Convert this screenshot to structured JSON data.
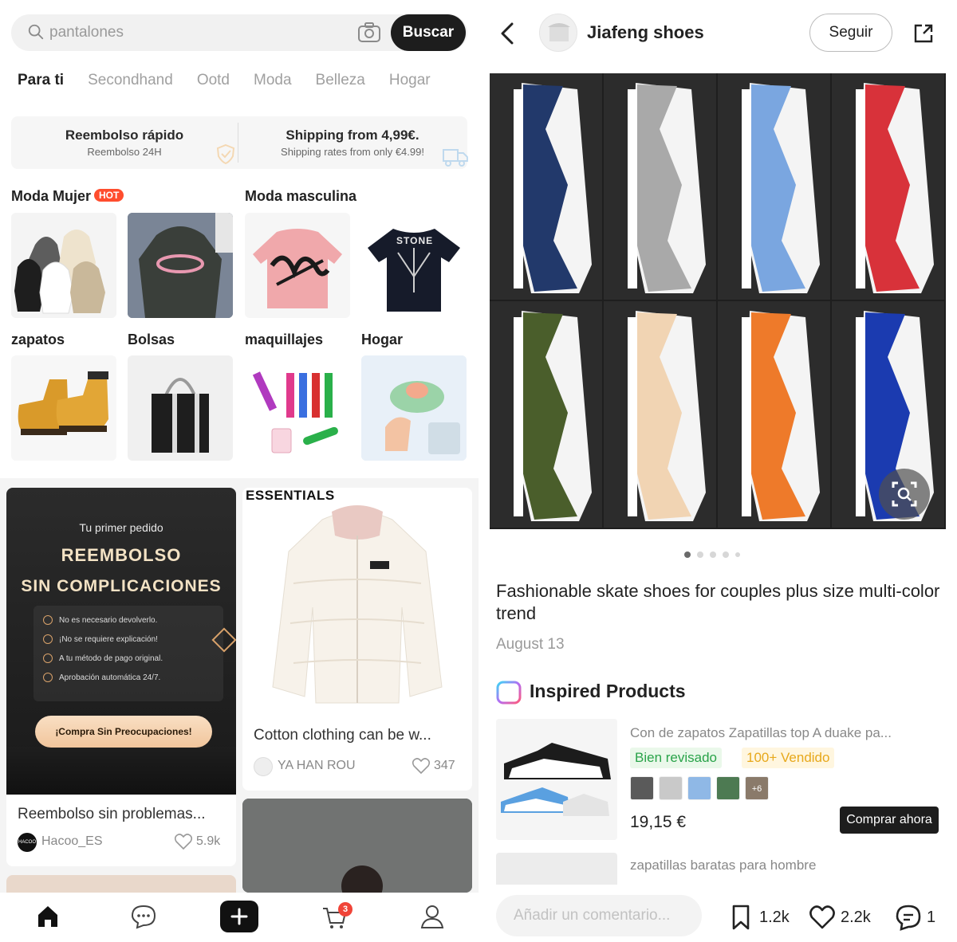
{
  "left": {
    "search": {
      "placeholder": "pantalones",
      "button": "Buscar"
    },
    "tabs": [
      "Para ti",
      "Secondhand",
      "Ootd",
      "Moda",
      "Belleza",
      "Hogar"
    ],
    "banner": {
      "left_title": "Reembolso rápido",
      "left_sub": "Reembolso 24H",
      "right_title": "Shipping from 4,99€.",
      "right_sub": "Shipping rates from only €4.99!"
    },
    "categories": {
      "moda_mujer": "Moda Mujer",
      "hot": "HOT",
      "moda_masculina": "Moda masculina",
      "zapatos": "zapatos",
      "bolsas": "Bolsas",
      "maquillajes": "maquillajes",
      "hogar": "Hogar"
    },
    "thumb_texts": {
      "stone": "STONE"
    },
    "promo": {
      "sub": "Tu primer pedido",
      "title1": "REEMBOLSO",
      "title2": "SIN COMPLICACIONES",
      "items": [
        "No es necesario devolverlo.",
        "¡No se requiere explicación!",
        "A tu método de pago original.",
        "Aprobación automática 24/7."
      ],
      "cta": "¡Compra Sin Preocupaciones!",
      "caption": "Reembolso sin problemas...",
      "author": "Hacoo_ES",
      "avatar_text": "HACOO",
      "likes": "5.9k"
    },
    "jacket": {
      "brand": "ESSENTIALS",
      "caption": "Cotton clothing can be w...",
      "author": "YA HAN ROU",
      "likes": "347"
    },
    "nav": {
      "cart_count": "3"
    }
  },
  "right": {
    "shop_name": "Jiafeng  shoes",
    "follow": "Seguir",
    "post_title": "Fashionable skate shoes for couples plus size multi-color trend",
    "date": "August 13",
    "inspired": "Inspired Products",
    "product1": {
      "name": "Con de zapatos Zapatillas top A duake pa...",
      "badge_ok": "Bien revisado",
      "badge_sold": "100+ Vendido",
      "more_count": "+6",
      "price": "19,15 €",
      "buy": "Comprar ahora"
    },
    "product2": {
      "name": "zapatillas baratas para hombre"
    },
    "comment_placeholder": "Añadir un comentario...",
    "stats": {
      "saves": "1.2k",
      "likes": "2.2k",
      "comments": "1"
    },
    "shoe_colors": [
      "#22396b",
      "#a9a9a9",
      "#7aa6e0",
      "#d8323a",
      "#4a5e2b",
      "#f1d4b3",
      "#ee7a2a",
      "#1b3bb0"
    ]
  }
}
